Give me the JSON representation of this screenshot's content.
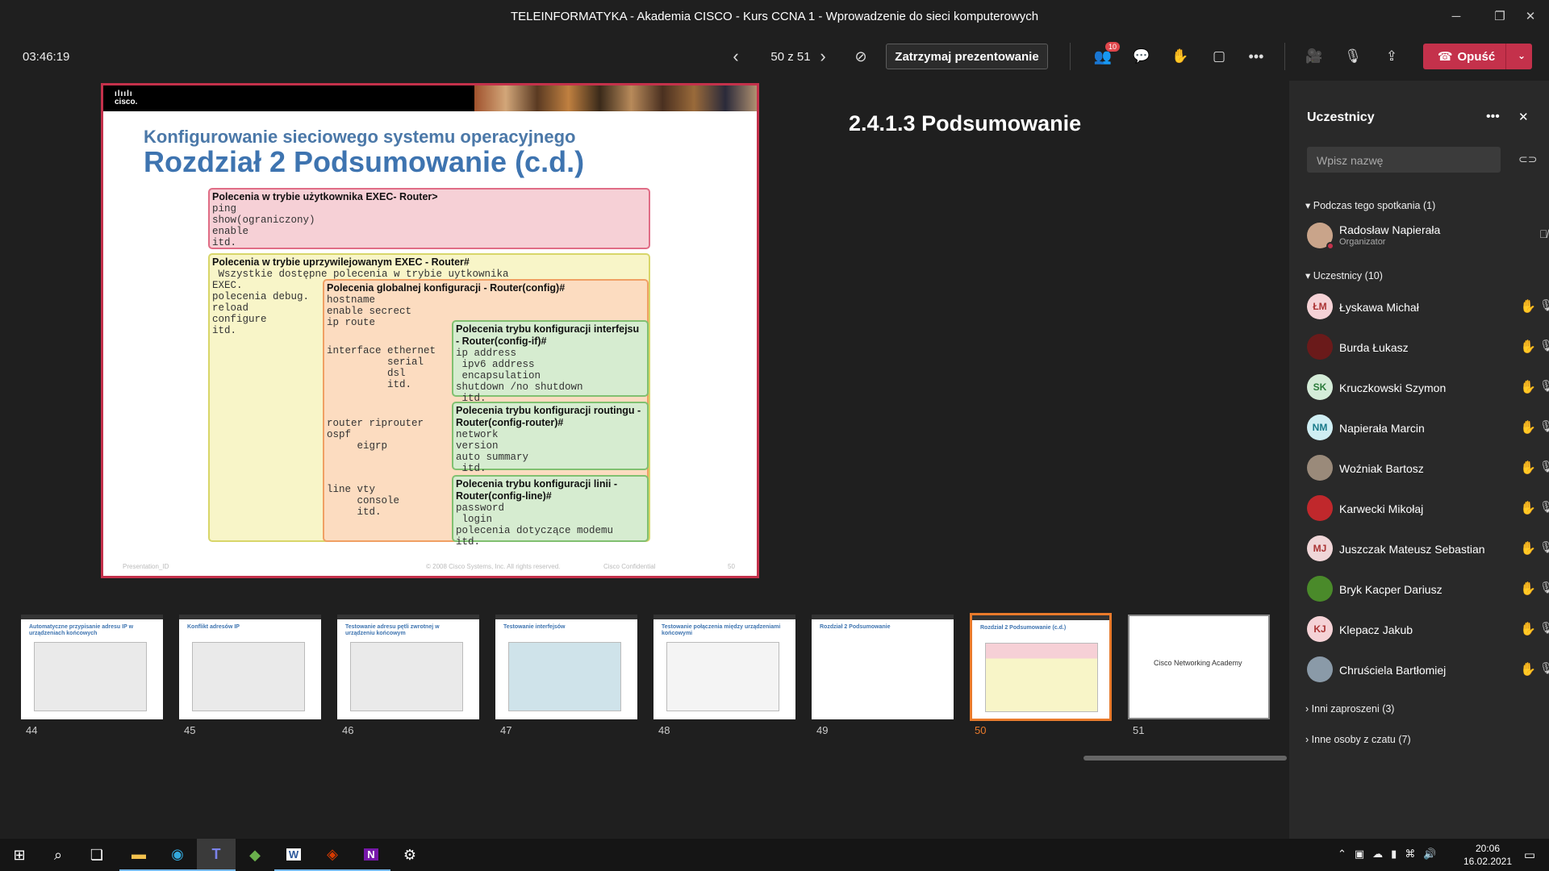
{
  "window": {
    "title": "TELEINFORMATYKA - Akademia CISCO - Kurs CCNA 1 - Wprowadzenie do sieci komputerowych"
  },
  "toolbar": {
    "timer": "03:46:19",
    "page_indicator": "50 z 51",
    "stop_presenting": "Zatrzymaj prezentowanie",
    "participants_badge": "10",
    "leave": "Opuść"
  },
  "slide": {
    "logo": "cisco.",
    "title_small": "Konfigurowanie sieciowego systemu operacyjnego",
    "title_big": "Rozdział 2 Podsumowanie (c.d.)",
    "user_box": {
      "header": "Polecenia w trybie użytkownika EXEC- Router>",
      "lines": "ping\nshow(ograniczony)\nenable\nitd."
    },
    "priv_box": {
      "header": "Polecenia w trybie uprzywilejowanym EXEC - Router#",
      "lines": " Wszystkie dostępne polecenia w trybie uytkownika\nEXEC.\npolecenia debug.\nreload\nconfigure\nitd."
    },
    "global_box": {
      "header": "Polecenia globalnej konfiguracji - Router(config)#",
      "lines": "hostname\nenable secrect\nip route",
      "interface": "interface ethernet\n          serial\n          dsl\n          itd.",
      "router": "router riprouter\nospf\n     eigrp",
      "line": "line vty\n     console\n     itd."
    },
    "if_box": {
      "header": "Polecenia trybu konfiguracji interfejsu - Router(config-if)#",
      "lines": "ip address\n ipv6 address\n encapsulation\nshutdown /no shutdown\n itd."
    },
    "rt_box": {
      "header": "Polecenia trybu konfiguracji routingu - Router(config-router)#",
      "lines": "network\nversion\nauto summary\n itd."
    },
    "ln_box": {
      "header": "Polecenia trybu konfiguracji linii - Router(config-line)#",
      "lines": "password\n login\npolecenia dotyczące modemu\nitd."
    },
    "footer_left": "Presentation_ID",
    "footer_mid": "© 2008 Cisco Systems, Inc. All rights reserved.",
    "footer_right": "Cisco Confidential",
    "footer_num": "50"
  },
  "slide_caption": "2.4.1.3 Podsumowanie",
  "thumbnails": [
    {
      "num": "44",
      "title": "Automatyczne przypisanie adresu IP w urządzeniach końcowych"
    },
    {
      "num": "45",
      "title": "Konflikt adresów IP"
    },
    {
      "num": "46",
      "title": "Testowanie adresu pętli zwrotnej w urządzeniu końcowym"
    },
    {
      "num": "47",
      "title": "Testowanie interfejsów"
    },
    {
      "num": "48",
      "title": "Testowanie połączenia między urządzeniami końcowymi"
    },
    {
      "num": "49",
      "title": "Rozdział 2 Podsumowanie"
    },
    {
      "num": "50",
      "title": "Rozdział 2 Podsumowanie (c.d.)"
    },
    {
      "num": "51",
      "title": "Cisco Networking Academy"
    }
  ],
  "panel": {
    "title": "Uczestnicy",
    "search_placeholder": "Wpisz nazwę",
    "section_meeting": "Podczas tego spotkania (1)",
    "organizer": {
      "name": "Radosław Napierała",
      "role": "Organizator"
    },
    "section_participants": "Uczestnicy (10)",
    "participants": [
      {
        "name": "Łyskawa Michał",
        "initials": "ŁM"
      },
      {
        "name": "Burda Łukasz",
        "initials": ""
      },
      {
        "name": "Kruczkowski Szymon",
        "initials": "SK"
      },
      {
        "name": "Napierała Marcin",
        "initials": "NM"
      },
      {
        "name": "Woźniak Bartosz",
        "initials": ""
      },
      {
        "name": "Karwecki Mikołaj",
        "initials": ""
      },
      {
        "name": "Juszczak Mateusz Sebastian",
        "initials": "MJ"
      },
      {
        "name": "Bryk Kacper Dariusz",
        "initials": ""
      },
      {
        "name": "Klepacz Jakub",
        "initials": "KJ"
      },
      {
        "name": "Chruściela Bartłomiej",
        "initials": ""
      }
    ],
    "section_invited": "Inni zaproszeni (3)",
    "section_chat": "Inne osoby z czatu (7)"
  },
  "taskbar": {
    "time": "20:06",
    "date": "16.02.2021"
  }
}
